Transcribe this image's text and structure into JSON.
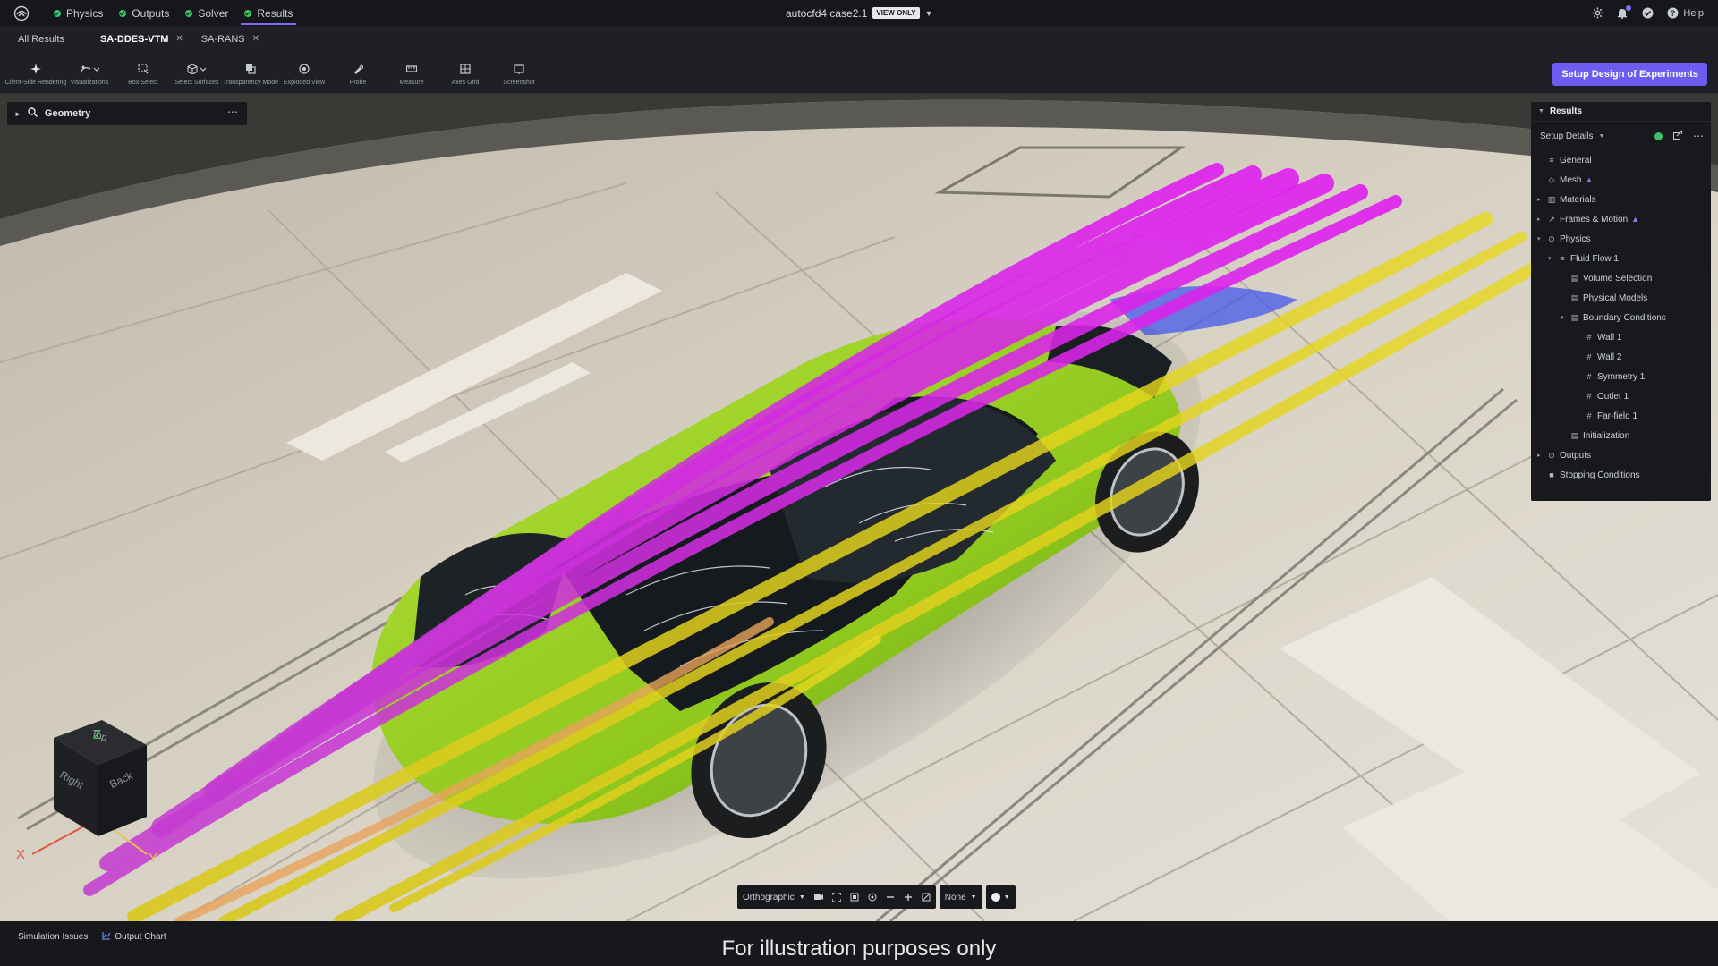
{
  "topbar": {
    "stages": [
      {
        "label": "Physics",
        "status": "complete"
      },
      {
        "label": "Outputs",
        "status": "complete"
      },
      {
        "label": "Solver",
        "status": "complete"
      },
      {
        "label": "Results",
        "status": "complete",
        "active": true
      }
    ],
    "project_name": "autocfd4 case2.1",
    "project_badge": "VIEW ONLY",
    "help_label": "Help",
    "icons": [
      "app-logo-icon",
      "settings-gear-icon",
      "bell-icon",
      "check-circle-icon",
      "help-circle-icon"
    ]
  },
  "result_tabs": {
    "all_results": "All Results",
    "tabs": [
      {
        "label": "SA-DDES-VTM",
        "selected": true
      },
      {
        "label": "SA-RANS",
        "selected": false
      }
    ]
  },
  "toolbar": {
    "tools": [
      {
        "label": "Client-Side Rendering",
        "icon": "sparkle-icon"
      },
      {
        "label": "Visualizations",
        "icon": "visualization-icon"
      },
      {
        "label": "Box Select",
        "icon": "box-select-icon"
      },
      {
        "label": "Select Surfaces",
        "icon": "cube-icon"
      },
      {
        "label": "Transparency Mode",
        "icon": "transparency-icon"
      },
      {
        "label": "Exploded View",
        "icon": "exploded-view-icon"
      },
      {
        "label": "Probe",
        "icon": "probe-icon"
      },
      {
        "label": "Measure",
        "icon": "ruler-icon"
      },
      {
        "label": "Axes Grid",
        "icon": "grid-icon"
      },
      {
        "label": "Screenshot",
        "icon": "screenshot-icon"
      }
    ],
    "doe_button": "Setup Design of Experiments"
  },
  "geometry_panel": {
    "title": "Geometry"
  },
  "results_panel": {
    "title": "Results",
    "setup_details": "Setup Details",
    "tree": [
      {
        "label": "General",
        "level": 0,
        "icon": "sliders-icon"
      },
      {
        "label": "Mesh",
        "level": 0,
        "icon": "mesh-icon",
        "flag": true
      },
      {
        "label": "Materials",
        "level": 0,
        "icon": "materials-icon",
        "arrow": "right"
      },
      {
        "label": "Frames & Motion",
        "level": 0,
        "icon": "motion-icon",
        "arrow": "right",
        "flag": true
      },
      {
        "label": "Physics",
        "level": 0,
        "icon": "physics-icon",
        "arrow": "down"
      },
      {
        "label": "Fluid Flow 1",
        "level": 1,
        "icon": "sliders-icon",
        "arrow": "down"
      },
      {
        "label": "Volume Selection",
        "level": 2,
        "icon": "table-icon"
      },
      {
        "label": "Physical Models",
        "level": 2,
        "icon": "table-icon"
      },
      {
        "label": "Boundary Conditions",
        "level": 2,
        "icon": "table-icon",
        "arrow": "down"
      },
      {
        "label": "Wall 1",
        "level": 3,
        "icon": "hash-icon"
      },
      {
        "label": "Wall 2",
        "level": 3,
        "icon": "hash-icon"
      },
      {
        "label": "Symmetry 1",
        "level": 3,
        "icon": "hash-icon"
      },
      {
        "label": "Outlet 1",
        "level": 3,
        "icon": "hash-icon"
      },
      {
        "label": "Far-field 1",
        "level": 3,
        "icon": "hash-icon"
      },
      {
        "label": "Initialization",
        "level": 2,
        "icon": "table-icon"
      },
      {
        "label": "Outputs",
        "level": 0,
        "icon": "outputs-icon",
        "arrow": "right"
      },
      {
        "label": "Stopping Conditions",
        "level": 0,
        "icon": "stop-icon"
      }
    ]
  },
  "orientation_cube": {
    "faces": [
      "Top",
      "Right",
      "Back"
    ],
    "axes": [
      "X",
      "Y",
      "Z"
    ]
  },
  "view_controls": {
    "projection": "Orthographic",
    "coloring": "None"
  },
  "bottom_bar": {
    "simulation_issues": "Simulation Issues",
    "output_chart": "Output Chart"
  },
  "caption": "For illustration purposes only",
  "colors": {
    "accent": "#6e5cf0",
    "status_ok": "#3cc46a",
    "car_body": "#8fc81e",
    "streamline_magenta": "#d21ee6",
    "streamline_yellow": "#e6d21e",
    "streamline_blue": "#3c50f0"
  }
}
